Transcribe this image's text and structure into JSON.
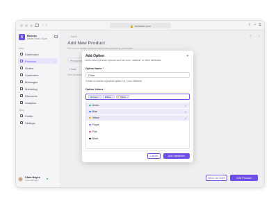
{
  "browser": {
    "url": "dotdash.com",
    "nav_glyphs": "‹ ›"
  },
  "sidebar": {
    "logo_letter": "B",
    "brand_name": "Boxera",
    "brand_sub": "Dealer Panel / Store",
    "general_label": "Menu",
    "items": [
      {
        "label": "Dashboard",
        "icon": "dashboard-icon"
      },
      {
        "label": "Products",
        "icon": "box-icon",
        "active": true
      },
      {
        "label": "Orders",
        "icon": "cart-icon"
      },
      {
        "label": "Customers",
        "icon": "users-icon"
      },
      {
        "label": "Messages",
        "icon": "chat-icon"
      },
      {
        "label": "Marketing",
        "icon": "megaphone-icon"
      },
      {
        "label": "Discounts",
        "icon": "tag-icon"
      },
      {
        "label": "Analytics",
        "icon": "chart-icon"
      }
    ],
    "other_label": "Other",
    "other_items": [
      {
        "label": "Profile",
        "icon": "user-icon"
      },
      {
        "label": "Settings",
        "icon": "gear-icon"
      }
    ],
    "user": {
      "name": "Clara Hayes",
      "role": "Store Manager"
    }
  },
  "main": {
    "back_label": "← Back",
    "title": "Add New Product",
    "subtitle": "Fill out the details below to add a new product to your store.",
    "bg_field": "Product title",
    "bg_add": "+ Add",
    "bg_hint": "Start by adding variants.",
    "save_draft": "Save as Draft",
    "add_product": "Add Product"
  },
  "modal": {
    "title": "Add Option",
    "description": "Add custom product options such as color, material, or other attributes.",
    "name_label": "Option Name",
    "name_value": "Color",
    "help": "Create or choose a product option e.g. Color, Material.",
    "values_label": "Option Values",
    "tags": [
      {
        "label": "Green",
        "color": "#22c55e"
      },
      {
        "label": "Blue",
        "color": "#3b82f6"
      },
      {
        "label": "Yellow",
        "color": "#eab308"
      }
    ],
    "options": [
      {
        "label": "Green",
        "color": "#22c55e",
        "selected": true
      },
      {
        "label": "Blue",
        "color": "#3b82f6",
        "selected": true
      },
      {
        "label": "Yellow",
        "color": "#eab308",
        "selected": true
      },
      {
        "label": "Purple",
        "color": "#8b5cf6",
        "selected": false
      },
      {
        "label": "Pink",
        "color": "#ec4899",
        "selected": false
      },
      {
        "label": "Black",
        "color": "#111827",
        "selected": false
      }
    ],
    "cancel": "Cancel",
    "add_variations": "Add Variations"
  },
  "colors": {
    "accent": "#6d4ee6"
  }
}
